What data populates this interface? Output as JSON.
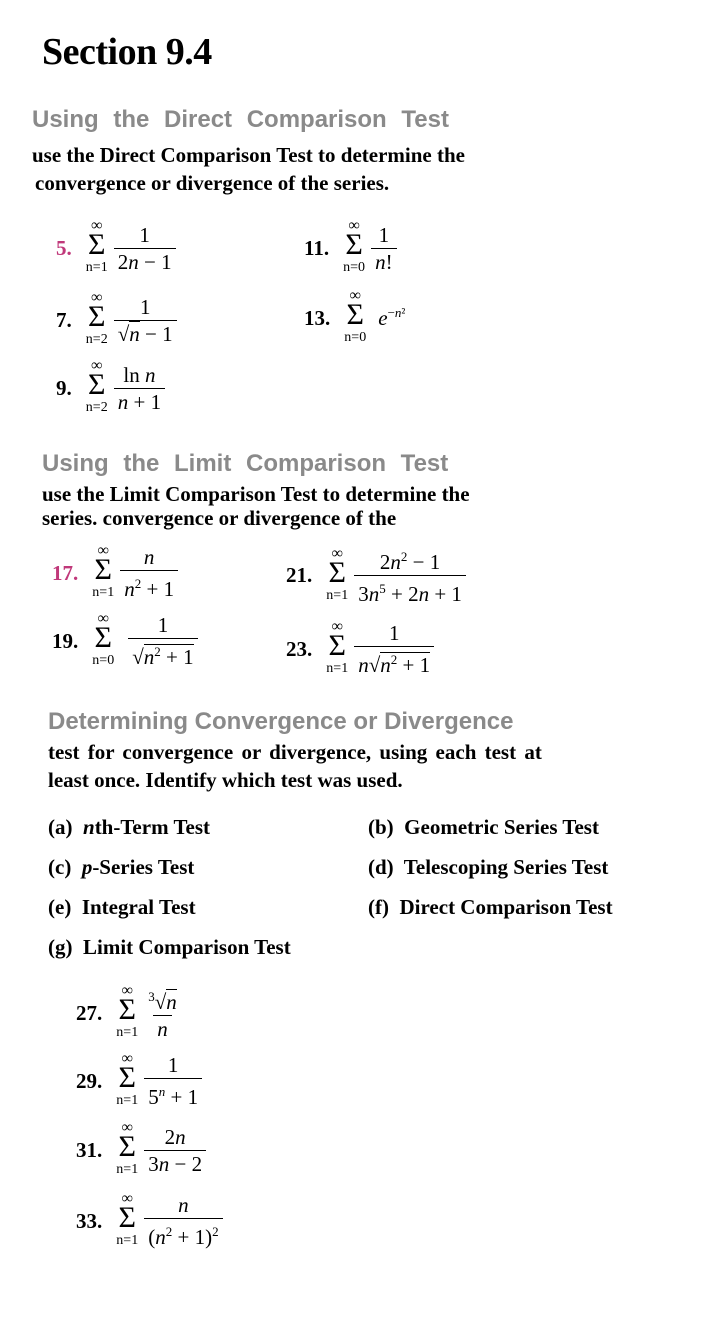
{
  "title": "Section 9.4",
  "sections": [
    {
      "heading": "Using the Direct Comparison Test",
      "instructions": [
        "use the Direct Comparison Test to determine the",
        "convergence or divergence of the series."
      ],
      "exercises": [
        {
          "number": "5.",
          "highlighted": true,
          "lower": "n=1",
          "upper": "∞",
          "numerator": "1",
          "denominator": "2n − 1"
        },
        {
          "number": "7.",
          "highlighted": false,
          "lower": "n=2",
          "upper": "∞",
          "numerator": "1",
          "denominator": "√n − 1"
        },
        {
          "number": "9.",
          "highlighted": false,
          "lower": "n=2",
          "upper": "∞",
          "numerator": "ln n",
          "denominator": "n + 1"
        },
        {
          "number": "11.",
          "highlighted": false,
          "lower": "n=0",
          "upper": "∞",
          "numerator": "1",
          "denominator": "n!"
        },
        {
          "number": "13.",
          "highlighted": false,
          "lower": "n=0",
          "upper": "∞",
          "term": "e^(−n²)"
        }
      ]
    },
    {
      "heading": "Using the Limit Comparison Test",
      "instructions": [
        "use the Limit Comparison Test to determine the",
        "series. convergence or divergence of the"
      ],
      "exercises": [
        {
          "number": "17.",
          "highlighted": true,
          "lower": "n=1",
          "upper": "∞",
          "numerator": "n",
          "denominator": "n² + 1"
        },
        {
          "number": "19.",
          "highlighted": false,
          "lower": "n=0",
          "upper": "∞",
          "numerator": "1",
          "denominator": "√(n² + 1)"
        },
        {
          "number": "21.",
          "highlighted": false,
          "lower": "n=1",
          "upper": "∞",
          "numerator": "2n² − 1",
          "denominator": "3n⁵ + 2n + 1"
        },
        {
          "number": "23.",
          "highlighted": false,
          "lower": "n=1",
          "upper": "∞",
          "numerator": "1",
          "denominator": "n√(n² + 1)"
        }
      ]
    },
    {
      "heading": "Determining Convergence or Divergence",
      "instructions": [
        "test for convergence or divergence, using each test at",
        "least once. Identify which test was used."
      ],
      "tests": [
        {
          "label": "(a)",
          "name": "nth-Term Test"
        },
        {
          "label": "(b)",
          "name": "Geometric Series Test"
        },
        {
          "label": "(c)",
          "name": "p-Series Test"
        },
        {
          "label": "(d)",
          "name": "Telescoping Series Test"
        },
        {
          "label": "(e)",
          "name": "Integral Test"
        },
        {
          "label": "(f)",
          "name": "Direct Comparison Test"
        },
        {
          "label": "(g)",
          "name": "Limit Comparison Test"
        }
      ],
      "exercises": [
        {
          "number": "27.",
          "highlighted": false,
          "lower": "n=1",
          "upper": "∞",
          "numerator": "∛n",
          "denominator": "n"
        },
        {
          "number": "29.",
          "highlighted": false,
          "lower": "n=1",
          "upper": "∞",
          "numerator": "1",
          "denominator": "5ⁿ + 1"
        },
        {
          "number": "31.",
          "highlighted": false,
          "lower": "n=1",
          "upper": "∞",
          "numerator": "2n",
          "denominator": "3n − 2"
        },
        {
          "number": "33.",
          "highlighted": false,
          "lower": "n=1",
          "upper": "∞",
          "numerator": "n",
          "denominator": "(n² + 1)²"
        }
      ]
    }
  ],
  "colors": {
    "highlight": "#c0387a",
    "heading": "#8a8a8a"
  }
}
